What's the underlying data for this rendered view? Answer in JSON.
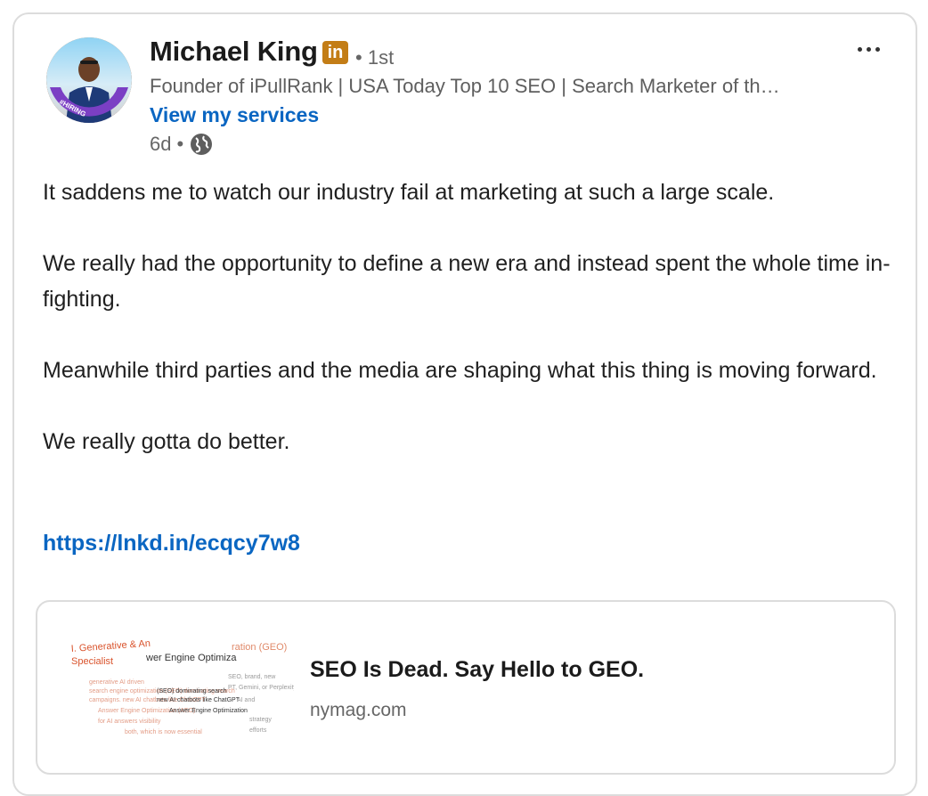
{
  "post": {
    "author": {
      "name": "Michael King",
      "network_badge": "in",
      "degree": "1st",
      "degree_separator": "•",
      "headline": "Founder of iPullRank | USA Today Top 10 SEO | Search Marketer of th…",
      "services_link": "View my services",
      "avatar_frame": "#HIRING"
    },
    "time_ago": "6d",
    "time_separator": "•",
    "visibility_icon": "globe-icon",
    "more_icon": "ellipsis-icon",
    "paragraphs": [
      "It saddens me to watch our industry fail at marketing at such a large scale.",
      "We really had the opportunity to define a new era and instead spent the whole time in-fighting.",
      "Meanwhile third parties and the media are shaping what this thing is moving forward.",
      "We really gotta do better."
    ],
    "link": "https://lnkd.in/ecqcy7w8"
  },
  "preview": {
    "title": "SEO Is Dead. Say Hello to GEO.",
    "domain": "nymag.com"
  },
  "colors": {
    "link_blue": "#0a66c2",
    "badge_gold": "#c37d16",
    "hiring_purple": "#7b3fc4"
  }
}
